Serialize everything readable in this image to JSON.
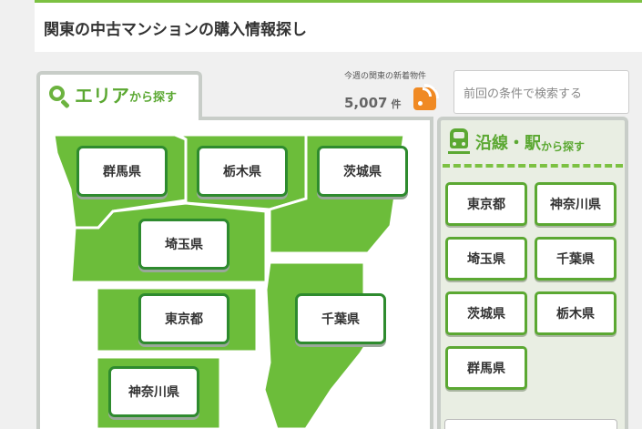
{
  "header": {
    "title": "関東の中古マンションの購入情報探し"
  },
  "area_tab": {
    "title_big": "エリア",
    "title_small": "から探す"
  },
  "new_listings": {
    "label": "今週の関東の新着物件",
    "count": "5,007",
    "unit": "件"
  },
  "prev_search": {
    "label": "前回の条件で検索する"
  },
  "map": {
    "colors": {
      "region": "#6cbd3a",
      "region_dark": "#5aa82e",
      "border": "#ffffff"
    },
    "prefectures": [
      "群馬県",
      "栃木県",
      "茨城県",
      "埼玉県",
      "東京都",
      "千葉県",
      "神奈川県"
    ]
  },
  "line_panel": {
    "title_big": "沿線・駅",
    "title_small": "から探す",
    "buttons": [
      "東京都",
      "神奈川県",
      "埼玉県",
      "千葉県",
      "茨城県",
      "栃木県",
      "群馬県"
    ]
  }
}
